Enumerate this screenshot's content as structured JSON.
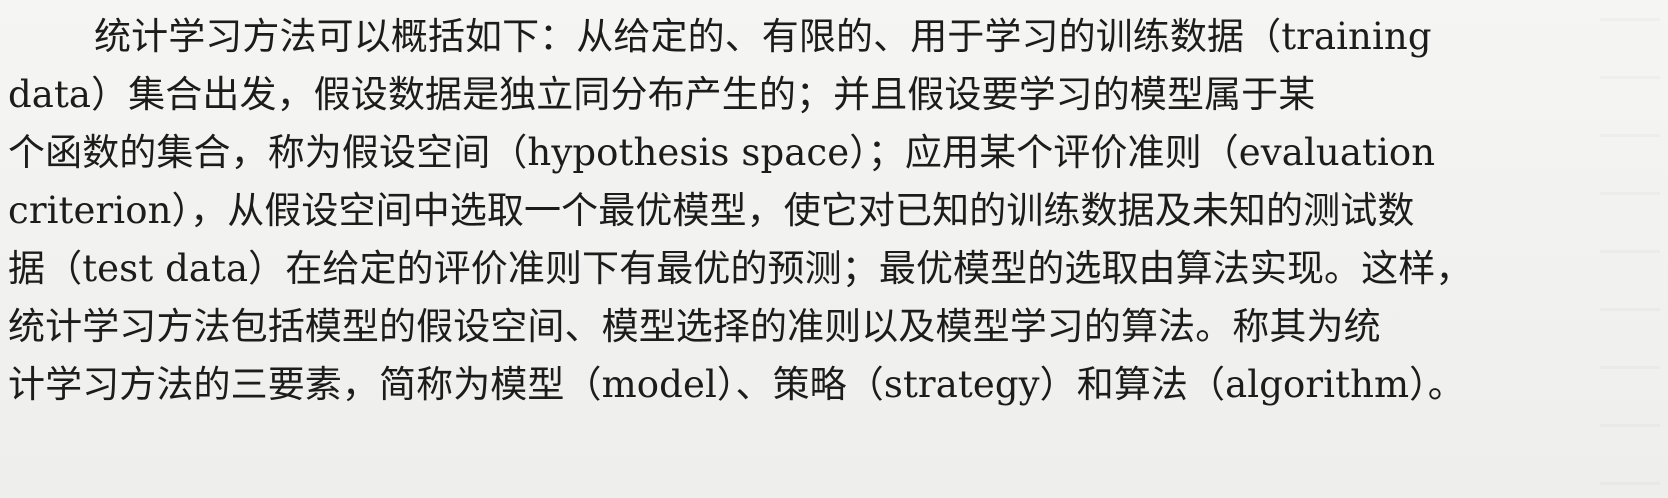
{
  "paragraph": {
    "lines": [
      "统计学习方法可以概括如下：从给定的、有限的、用于学习的训练数据（training",
      "data）集合出发，假设数据是独立同分布产生的；并且假设要学习的模型属于某",
      "个函数的集合，称为假设空间（hypothesis space）；应用某个评价准则（evaluation",
      "criterion），从假设空间中选取一个最优模型，使它对已知的训练数据及未知的测试数",
      "据（test data）在给定的评价准则下有最优的预测；最优模型的选取由算法实现。这样，",
      "统计学习方法包括模型的假设空间、模型选择的准则以及模型学习的算法。称其为统",
      "计学习方法的三要素，简称为模型（model）、策略（strategy）和算法（algorithm）。"
    ]
  }
}
